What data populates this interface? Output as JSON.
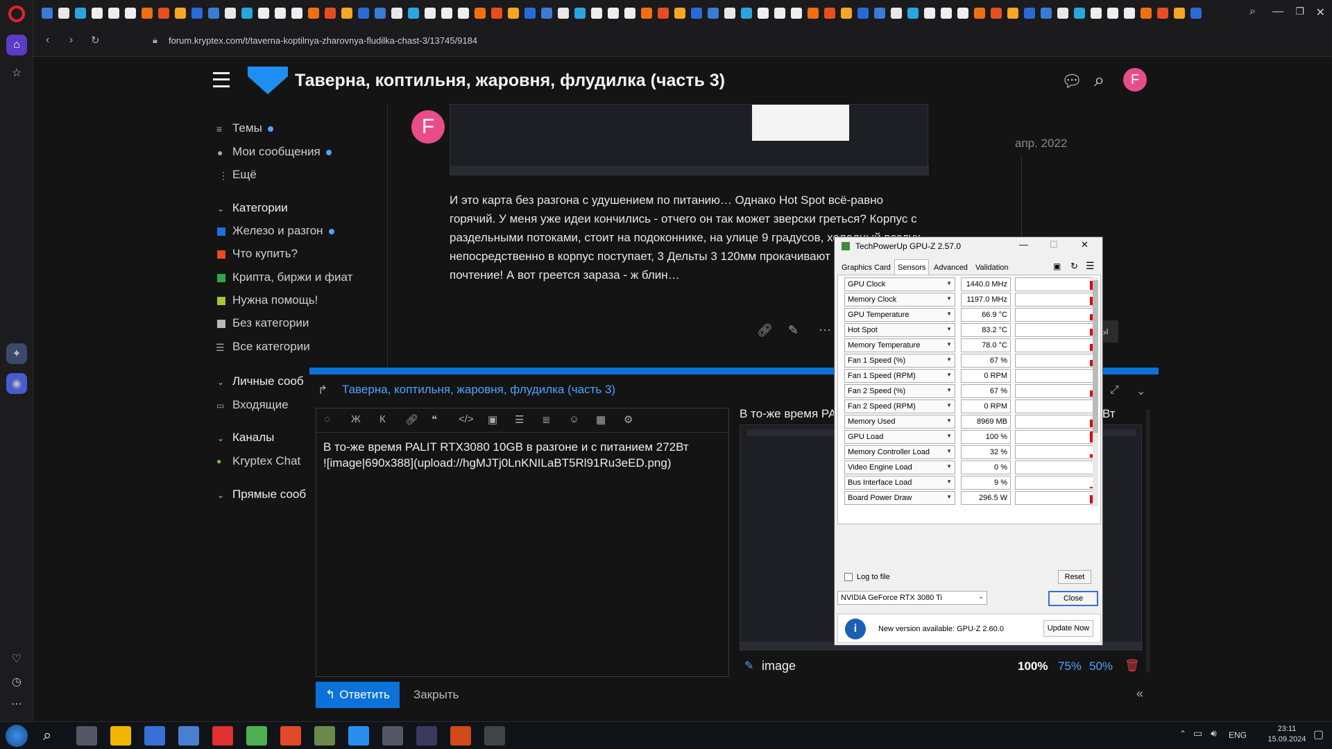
{
  "browser": {
    "url": "forum.kryptex.com/t/taverna-koptilnya-zharovnya-fludilka-chast-3/13745/9184"
  },
  "header": {
    "title": "Таверна, коптильня, жаровня, флудилка (часть 3)",
    "avatar_letter": "F"
  },
  "sidebar": {
    "items": [
      {
        "label": "Темы"
      },
      {
        "label": "Мои сообщения"
      },
      {
        "label": "Ещё"
      }
    ],
    "categories_title": "Категории",
    "categories": [
      {
        "label": "Железо и разгон",
        "color": "#1e6fe0"
      },
      {
        "label": "Что купить?",
        "color": "#e84d1e"
      },
      {
        "label": "Крипта, биржи и фиат",
        "color": "#2fa84a"
      },
      {
        "label": "Нужна помощь!",
        "color": "#a5c62f"
      },
      {
        "label": "Без категории",
        "color": "#b8b8b8"
      },
      {
        "label": "Все категории",
        "color": ""
      }
    ],
    "personal_title": "Личные сооб",
    "inbox": "Входящие",
    "channels_title": "Каналы",
    "channel": "Kryptex Chat",
    "dm_title": "Прямые сооб"
  },
  "post": {
    "avatar_letter": "F",
    "date": "апр. 2022",
    "text": "И это карта без разгона с удушением по питанию… Однако Hot Spot всё-равно горячий. У меня уже идеи кончились - отчего он так может зверски греться? Корпус с раздельными потоками, стоит на подоконнике, на улице 9 градусов, холодный воздух непосредственно в корпус поступает, 3 Дельты 3 120мм прокачивают воздух - моё почтение! А вот греется зараза - ж блин…",
    "reply_label": "ты"
  },
  "composer": {
    "topic": "Таверна, коптильня, жаровня, флудилка (часть 3)",
    "toolbar": [
      "Ж",
      "К"
    ],
    "text_line1": "В то-же время PALIT RTX3080 10GB в разгоне и с питанием 272Вт",
    "text_line2": "![image|690x388](upload://hgMJTj0LnKNILaBT5Rl91Ru3eED.png)",
    "reply_button": "Ответить",
    "close_button": "Закрыть",
    "preview_title": "В то-же время PA",
    "preview_suffix": "Вт",
    "image_label": "image",
    "zoom": [
      "100%",
      "75%",
      "50%"
    ]
  },
  "gpuz": {
    "title": "TechPowerUp GPU-Z 2.57.0",
    "tabs": [
      "Graphics Card",
      "Sensors",
      "Advanced",
      "Validation"
    ],
    "sensors": [
      {
        "name": "GPU Clock",
        "value": "1440.0 MHz",
        "level": 0.8
      },
      {
        "name": "Memory Clock",
        "value": "1197.0 MHz",
        "level": 0.75
      },
      {
        "name": "GPU Temperature",
        "value": "66.9 °C",
        "level": 0.55
      },
      {
        "name": "Hot Spot",
        "value": "83.2 °C",
        "level": 0.65
      },
      {
        "name": "Memory Temperature",
        "value": "78.0 °C",
        "level": 0.6
      },
      {
        "name": "Fan 1 Speed (%)",
        "value": "67 %",
        "level": 0.55
      },
      {
        "name": "Fan 1 Speed (RPM)",
        "value": "0 RPM",
        "level": 0
      },
      {
        "name": "Fan 2 Speed (%)",
        "value": "67 %",
        "level": 0.55
      },
      {
        "name": "Fan 2 Speed (RPM)",
        "value": "0 RPM",
        "level": 0
      },
      {
        "name": "Memory Used",
        "value": "8969 MB",
        "level": 0.7
      },
      {
        "name": "GPU Load",
        "value": "100 %",
        "level": 1
      },
      {
        "name": "Memory Controller Load",
        "value": "32 %",
        "level": 0.3
      },
      {
        "name": "Video Engine Load",
        "value": "0 %",
        "level": 0
      },
      {
        "name": "Bus Interface Load",
        "value": "9 %",
        "level": 0.1
      },
      {
        "name": "Board Power Draw",
        "value": "296.5 W",
        "level": 0.75
      }
    ],
    "log_label": "Log to file",
    "reset": "Reset",
    "gpu_name": "NVIDIA GeForce RTX 3080 Ti",
    "close": "Close",
    "update_text": "New version available: GPU-Z 2.60.0",
    "update_button": "Update Now"
  },
  "tray": {
    "lang": "ENG",
    "time": "23:11",
    "date": "15.09.2024"
  }
}
